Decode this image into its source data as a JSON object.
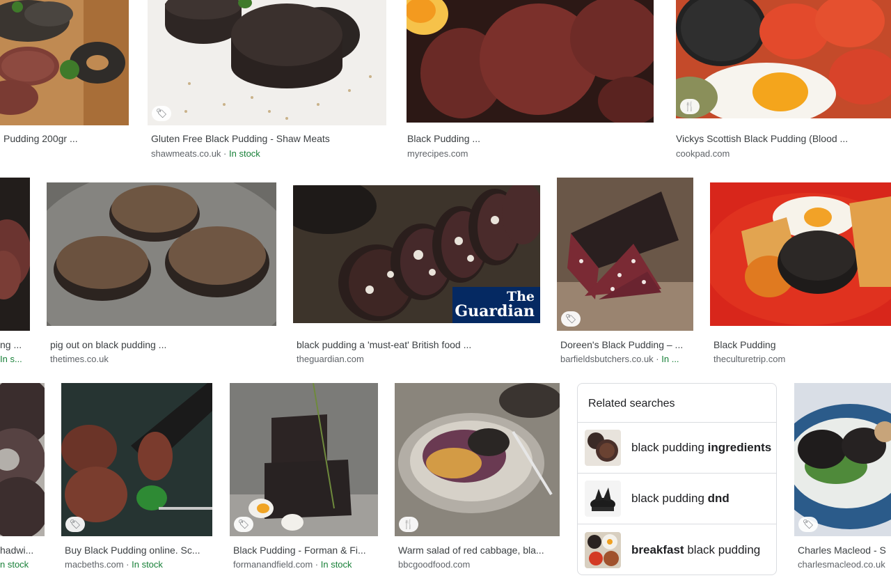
{
  "colors": {
    "title": "#3c4043",
    "domain": "#5f6368",
    "in_stock": "#188038",
    "border": "#dadce0"
  },
  "results": [
    {
      "title": "Pudding 200gr ...",
      "domain": "",
      "stock": "",
      "badge": ""
    },
    {
      "title": "Gluten Free Black Pudding - Shaw Meats",
      "domain": "shawmeats.co.uk",
      "stock": "In stock",
      "badge": "tag-icon"
    },
    {
      "title": "Black Pudding ...",
      "domain": "myrecipes.com",
      "stock": "",
      "badge": ""
    },
    {
      "title": "Vickys Scottish Black Pudding (Blood ...",
      "domain": "cookpad.com",
      "stock": "",
      "badge": "recipe-icon"
    },
    {
      "title": "ng ...",
      "domain": "",
      "stock": "In s...",
      "badge": ""
    },
    {
      "title": "pig out on black pudding ...",
      "domain": "thetimes.co.uk",
      "stock": "",
      "badge": ""
    },
    {
      "title": "black pudding a 'must-eat' British food ...",
      "domain": "theguardian.com",
      "stock": "",
      "badge": "",
      "watermark_lines": [
        "The",
        "Guardian"
      ]
    },
    {
      "title": "Doreen's Black Pudding – ...",
      "domain": "barfieldsbutchers.co.uk",
      "stock": "In ...",
      "badge": "tag-icon"
    },
    {
      "title": "Black Pudding",
      "domain": "theculturetrip.com",
      "stock": "",
      "badge": ""
    },
    {
      "title": "hadwi...",
      "domain": "",
      "stock": "n stock",
      "badge": ""
    },
    {
      "title": "Buy Black Pudding online. Sc...",
      "domain": "macbeths.com",
      "stock": "In stock",
      "badge": "tag-icon"
    },
    {
      "title": "Black Pudding - Forman & Fi...",
      "domain": "formanandfield.com",
      "stock": "In stock",
      "badge": "tag-icon"
    },
    {
      "title": "Warm salad of red cabbage, bla...",
      "domain": "bbcgoodfood.com",
      "stock": "",
      "badge": "recipe-icon"
    },
    {
      "title": "Charles Macleod - S",
      "domain": "charlesmacleod.co.uk",
      "stock": "",
      "badge": "tag-icon"
    }
  ],
  "related": {
    "heading": "Related searches",
    "items": [
      {
        "prefix": "black pudding ",
        "bold": "ingredients",
        "suffix": ""
      },
      {
        "prefix": "black pudding ",
        "bold": "dnd",
        "suffix": ""
      },
      {
        "prefix": "",
        "bold": "breakfast",
        "suffix": " black pudding"
      }
    ]
  }
}
